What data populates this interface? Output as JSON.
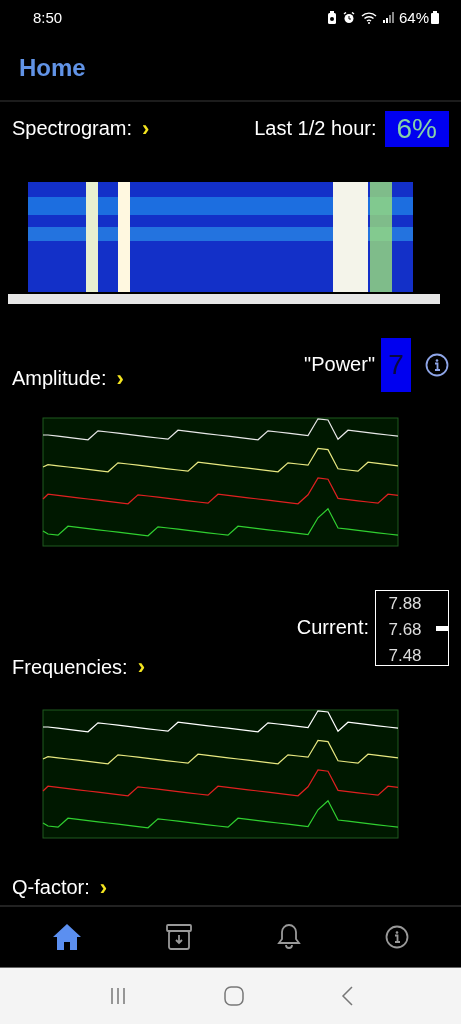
{
  "status_bar": {
    "time": "8:50",
    "battery": "64%"
  },
  "app_bar": {
    "title": "Home"
  },
  "spectrogram": {
    "label": "Spectrogram:",
    "chevron": "›",
    "last_label": "Last 1/2 hour:",
    "last_value": "6%",
    "image": {
      "kind": "picture"
    }
  },
  "amplitude": {
    "label": "Amplitude:",
    "chevron": "›",
    "power_label": "\"Power\"",
    "power_value": "7",
    "image": {
      "kind": "picture"
    }
  },
  "frequencies": {
    "label": "Frequencies:",
    "chevron": "›",
    "current_label": "Current:",
    "scale": [
      "7.88",
      "7.68",
      "7.48"
    ],
    "image": {
      "kind": "picture"
    }
  },
  "qfactor": {
    "label": "Q-factor:",
    "chevron": "›"
  },
  "bottom_nav": [
    {
      "kind": "home",
      "selected": true
    },
    {
      "kind": "archive",
      "selected": false
    },
    {
      "kind": "bell",
      "selected": false
    },
    {
      "kind": "info",
      "selected": false
    }
  ]
}
